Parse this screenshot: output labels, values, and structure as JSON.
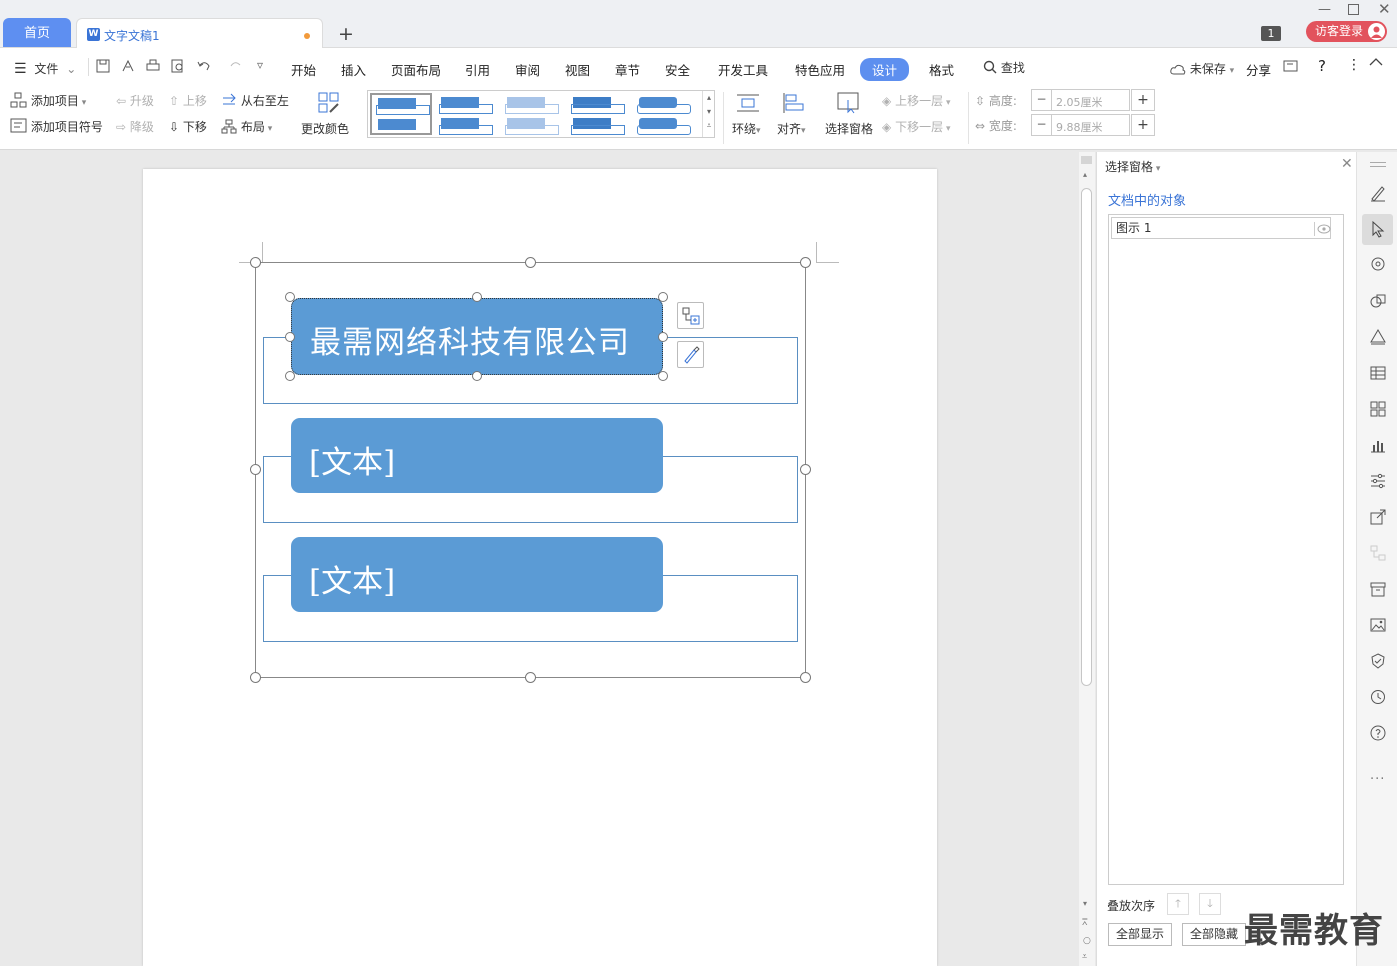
{
  "tabs": {
    "home": "首页",
    "doc": "文字文稿1"
  },
  "window": {
    "badge": "1",
    "login": "访客登录"
  },
  "menu": {
    "file": "文件",
    "items": [
      "开始",
      "插入",
      "页面布局",
      "引用",
      "审阅",
      "视图",
      "章节",
      "安全",
      "开发工具",
      "特色应用",
      "设计",
      "格式"
    ],
    "active": "设计",
    "search": "查找",
    "unsaved": "未保存",
    "share": "分享",
    "help": "?"
  },
  "ribbon": {
    "add_item": "添加项目",
    "add_bullet": "添加项目符号",
    "promote": "升级",
    "demote": "降级",
    "move_up": "上移",
    "move_down": "下移",
    "rtl": "从右至左",
    "layout": "布局",
    "change_color": "更改颜色",
    "wrap": "环绕",
    "align": "对齐",
    "selection_pane": "选择窗格",
    "bring_forward": "上移一层",
    "send_backward": "下移一层",
    "height_label": "高度:",
    "height_value": "2.05厘米",
    "width_label": "宽度:",
    "width_value": "9.88厘米"
  },
  "document": {
    "boxes": [
      "最需网络科技有限公司",
      "[文本]",
      "[文本]"
    ]
  },
  "pane": {
    "title": "选择窗格",
    "subtitle": "文档中的对象",
    "objects": [
      "图示 1"
    ],
    "stack_order": "叠放次序",
    "show_all": "全部显示",
    "hide_all": "全部隐藏"
  },
  "watermark": "最需教育",
  "colors": {
    "accent": "#5d8fef",
    "smartart_fill": "#5b9bd5",
    "login_red": "#e2535d"
  }
}
